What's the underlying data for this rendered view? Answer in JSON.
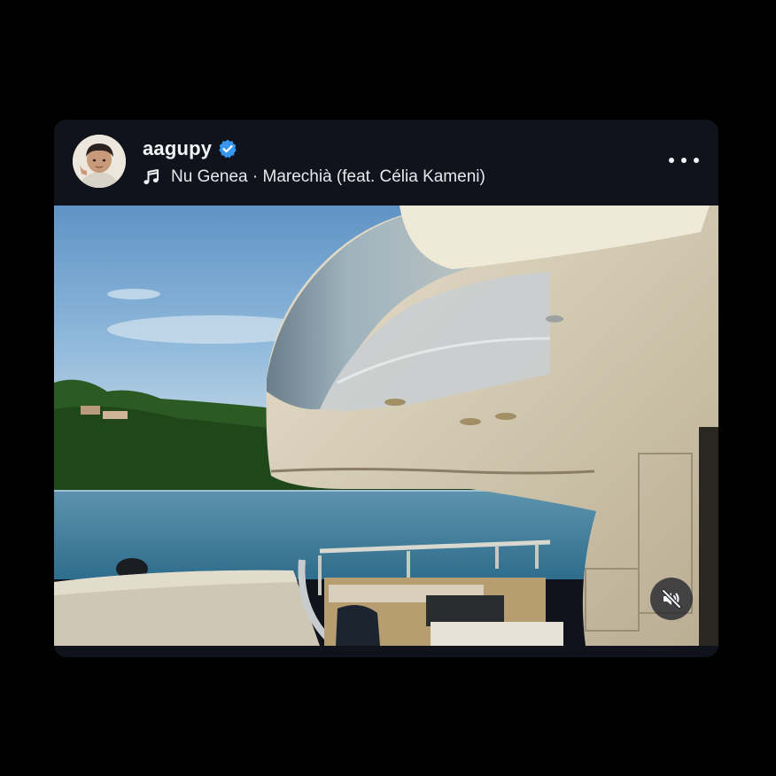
{
  "post": {
    "username": "aagupy",
    "verified": true,
    "music_label": "Nu Genea · Marechià (feat. Célia Kameni)"
  },
  "icons": {
    "verified": "verified-badge-icon",
    "music": "music-note-icon",
    "more": "more-options-icon",
    "mute": "speaker-muted-icon"
  },
  "colors": {
    "background": "#000000",
    "card": "#10131b",
    "verified_blue": "#3797f0",
    "text": "#f4f5f7"
  }
}
